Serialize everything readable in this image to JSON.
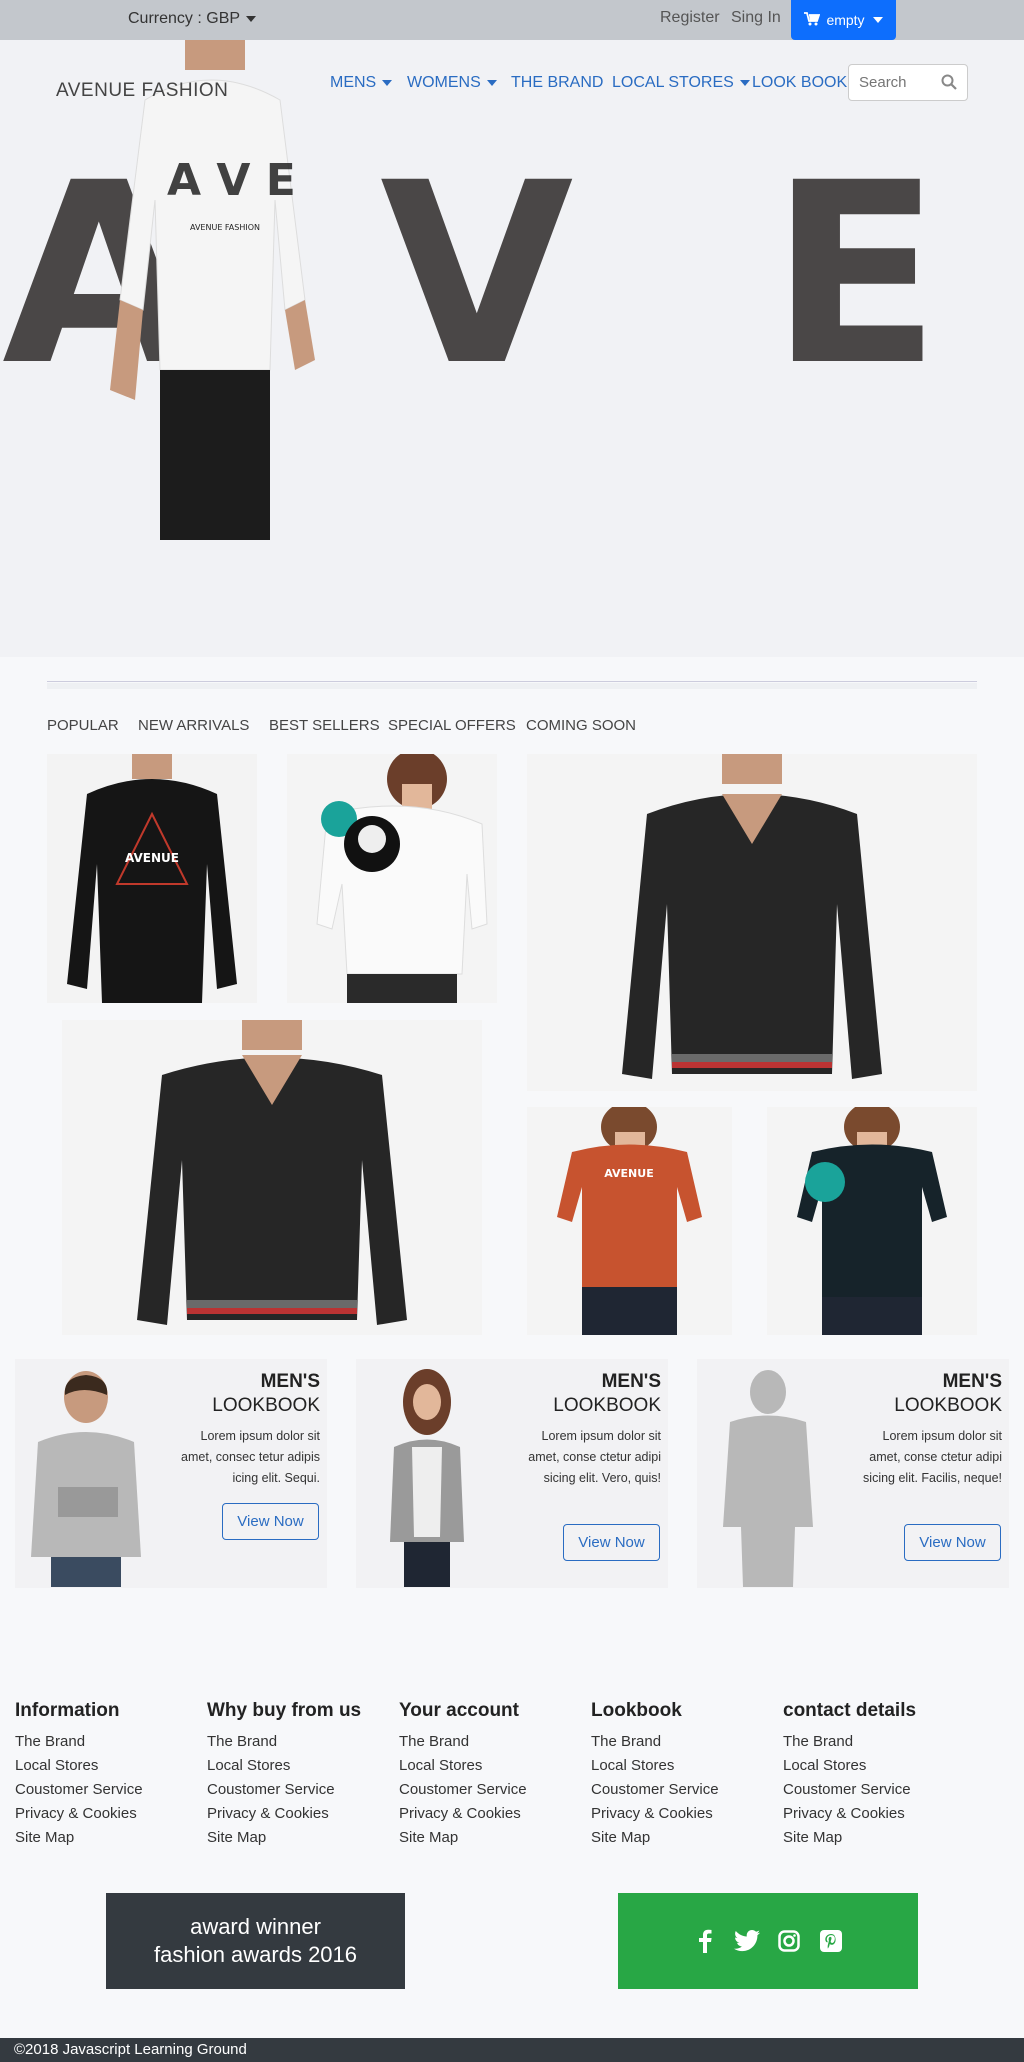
{
  "topbar": {
    "currency_label": "Currency : GBP",
    "register": "Register",
    "signin": "Sing In",
    "cart_label": "empty"
  },
  "header": {
    "brand": "AVENUE FASHION",
    "hero_letters": [
      "A",
      "V",
      "E"
    ],
    "nav": [
      "MENS",
      "WOMENS",
      "THE BRAND",
      "LOCAL STORES",
      "LOOK BOOK"
    ],
    "search_placeholder": "Search"
  },
  "tabs": [
    "POPULAR",
    "NEW ARRIVALS",
    "BEST SELLERS",
    "SPECIAL OFFERS",
    "COMING SOON"
  ],
  "lookbook": [
    {
      "title_line1": "MEN'S",
      "title_line2": "LOOKBOOK",
      "text": "Lorem ipsum dolor sit amet, consec tetur adipis icing elit. Sequi.",
      "button": "View Now"
    },
    {
      "title_line1": "MEN'S",
      "title_line2": "LOOKBOOK",
      "text": "Lorem ipsum dolor sit amet, conse ctetur adipi sicing elit. Vero, quis!",
      "button": "View Now"
    },
    {
      "title_line1": "MEN'S",
      "title_line2": "LOOKBOOK",
      "text": "Lorem ipsum dolor sit amet, conse ctetur adipi sicing elit. Facilis, neque!",
      "button": "View Now"
    }
  ],
  "footer": {
    "columns": [
      {
        "heading": "Information",
        "links": [
          "The Brand",
          "Local Stores",
          "Coustomer Service",
          "Privacy & Cookies",
          "Site Map"
        ]
      },
      {
        "heading": "Why buy from us",
        "links": [
          "The Brand",
          "Local Stores",
          "Coustomer Service",
          "Privacy & Cookies",
          "Site Map"
        ]
      },
      {
        "heading": "Your account",
        "links": [
          "The Brand",
          "Local Stores",
          "Coustomer Service",
          "Privacy & Cookies",
          "Site Map"
        ]
      },
      {
        "heading": "Lookbook",
        "links": [
          "The Brand",
          "Local Stores",
          "Coustomer Service",
          "Privacy & Cookies",
          "Site Map"
        ]
      },
      {
        "heading": "contact details",
        "links": [
          "The Brand",
          "Local Stores",
          "Coustomer Service",
          "Privacy & Cookies",
          "Site Map"
        ]
      }
    ],
    "award_line1": "award winner",
    "award_line2": "fashion awards 2016",
    "social_icons": [
      "facebook-icon",
      "twitter-icon",
      "instagram-icon",
      "pinterest-icon"
    ],
    "copyright": "©2018 Javascript Learning Ground"
  },
  "colors": {
    "topbar": "#c3c7cc",
    "cart_button": "#0d6efd",
    "nav_link": "#2a6cc2",
    "dark": "#343a40",
    "social_green": "#28a745"
  }
}
